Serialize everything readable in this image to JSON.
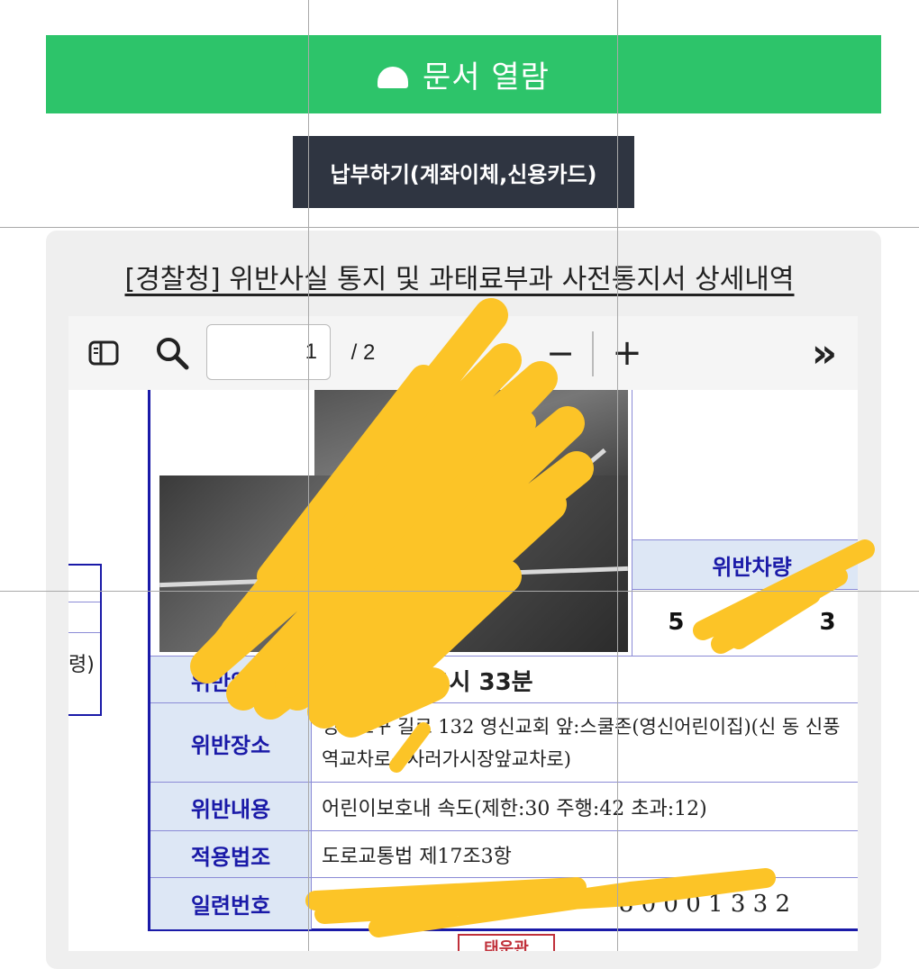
{
  "header": {
    "open_label": "문서 열람",
    "pay_label": "납부하기(계좌이체,신용카드)"
  },
  "panel": {
    "title": "[경찰청] 위반사실 통지 및 과태료부과 사전통지서 상세내역"
  },
  "toolbar": {
    "sidebar_icon": "sidebar-toggle-icon",
    "search_icon": "search-icon",
    "page_value": "1",
    "page_total": "/ 2",
    "zoom_out": "−",
    "zoom_in": "+",
    "more": "»"
  },
  "document": {
    "left_fragment": "령)",
    "vehicle_header": "위반차량",
    "vehicle_value": "5",
    "vehicle_value_end": "3",
    "rows": [
      {
        "label": "위반일시",
        "value": "2024년 14시 33분"
      },
      {
        "label": "위반장소",
        "value": "영등포구 길로 132 영신교회 앞:스쿨존(영신어린이집)(신 동 신풍역교차로→사러가시장앞교차로)"
      },
      {
        "label": "위반내용",
        "value": "어린이보호내 속도(제한:30 주행:42 초과:12)"
      },
      {
        "label": "적용법조",
        "value": "도로교통법 제17조3항"
      },
      {
        "label": "일련번호",
        "value": "8 0 0 0 1 3 3 2"
      }
    ],
    "seal_text": "태운관"
  },
  "colors": {
    "green": "#2dc46a",
    "dark": "#2f3541",
    "table_border": "#1a1aa8",
    "label_bg": "#dde7f5",
    "scribble": "#fcc427"
  }
}
